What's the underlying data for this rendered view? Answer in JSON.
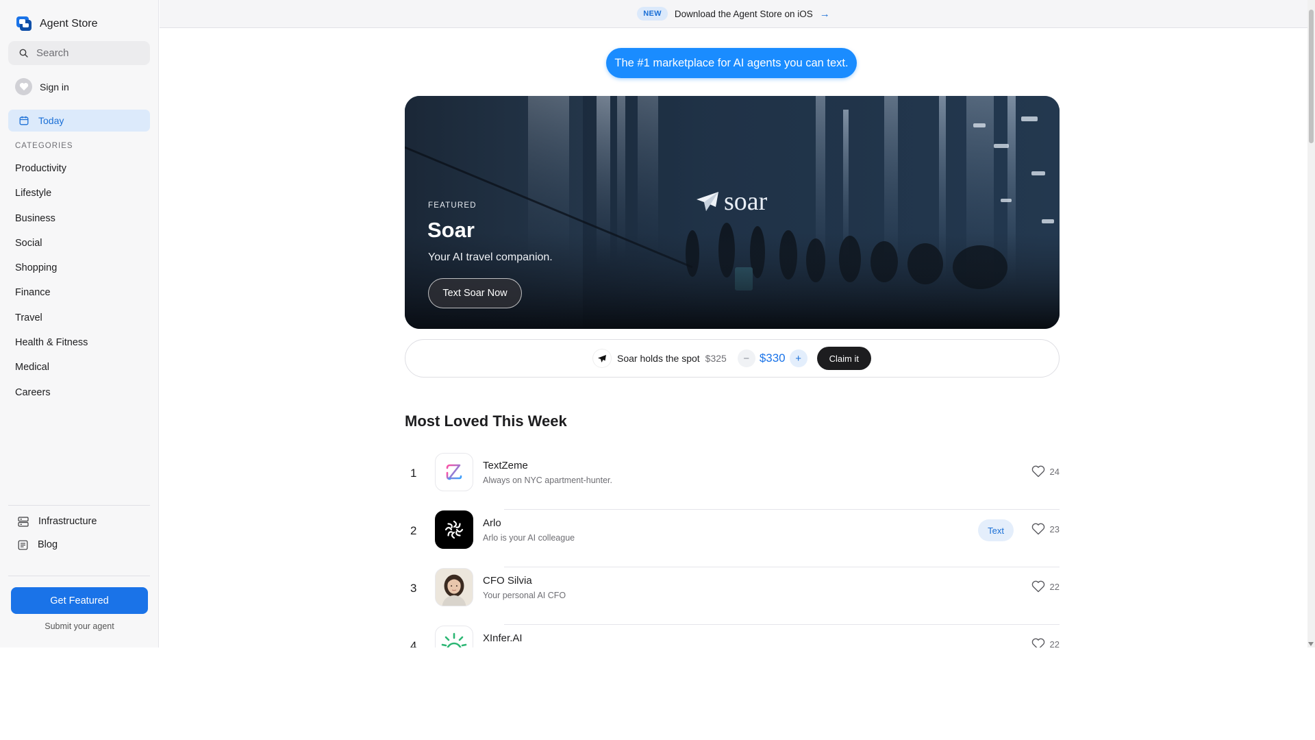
{
  "sidebar": {
    "brand": "Agent Store",
    "search_placeholder": "Search",
    "sign_in": "Sign in",
    "today": "Today",
    "categories_heading": "CATEGORIES",
    "categories": [
      "Productivity",
      "Lifestyle",
      "Business",
      "Social",
      "Shopping",
      "Finance",
      "Travel",
      "Health & Fitness",
      "Medical",
      "Careers"
    ],
    "infrastructure": "Infrastructure",
    "blog": "Blog",
    "get_featured": "Get Featured",
    "submit_agent": "Submit your agent"
  },
  "topbar": {
    "badge": "NEW",
    "text": "Download the Agent Store on iOS",
    "arrow": "→"
  },
  "tagline": "The #1 marketplace for AI agents you can text.",
  "hero": {
    "label": "FEATURED",
    "title": "Soar",
    "subtitle": "Your AI travel companion.",
    "button": "Text Soar Now",
    "logo_text": "soar"
  },
  "spot": {
    "text": "Soar holds the spot",
    "current_price": "$325",
    "minus": "−",
    "bid_price": "$330",
    "plus": "+",
    "claim": "Claim it"
  },
  "most_loved": {
    "title": "Most Loved This Week",
    "items": [
      {
        "rank": "1",
        "name": "TextZeme",
        "desc": "Always on NYC apartment-hunter.",
        "likes": "24",
        "icon": "textzeme-logo"
      },
      {
        "rank": "2",
        "name": "Arlo",
        "desc": "Arlo is your AI colleague",
        "likes": "23",
        "action": "Text",
        "icon": "arlo-logo"
      },
      {
        "rank": "3",
        "name": "CFO Silvia",
        "desc": "Your personal AI CFO",
        "likes": "22",
        "icon": "silvia-avatar"
      },
      {
        "rank": "4",
        "name": "XInfer.AI",
        "desc": "",
        "likes": "22",
        "icon": "xinfer-logo"
      }
    ]
  },
  "colors": {
    "accent": "#1a73e8",
    "tagline_bg": "#1a8cff",
    "active_nav_bg": "#dceafb"
  }
}
